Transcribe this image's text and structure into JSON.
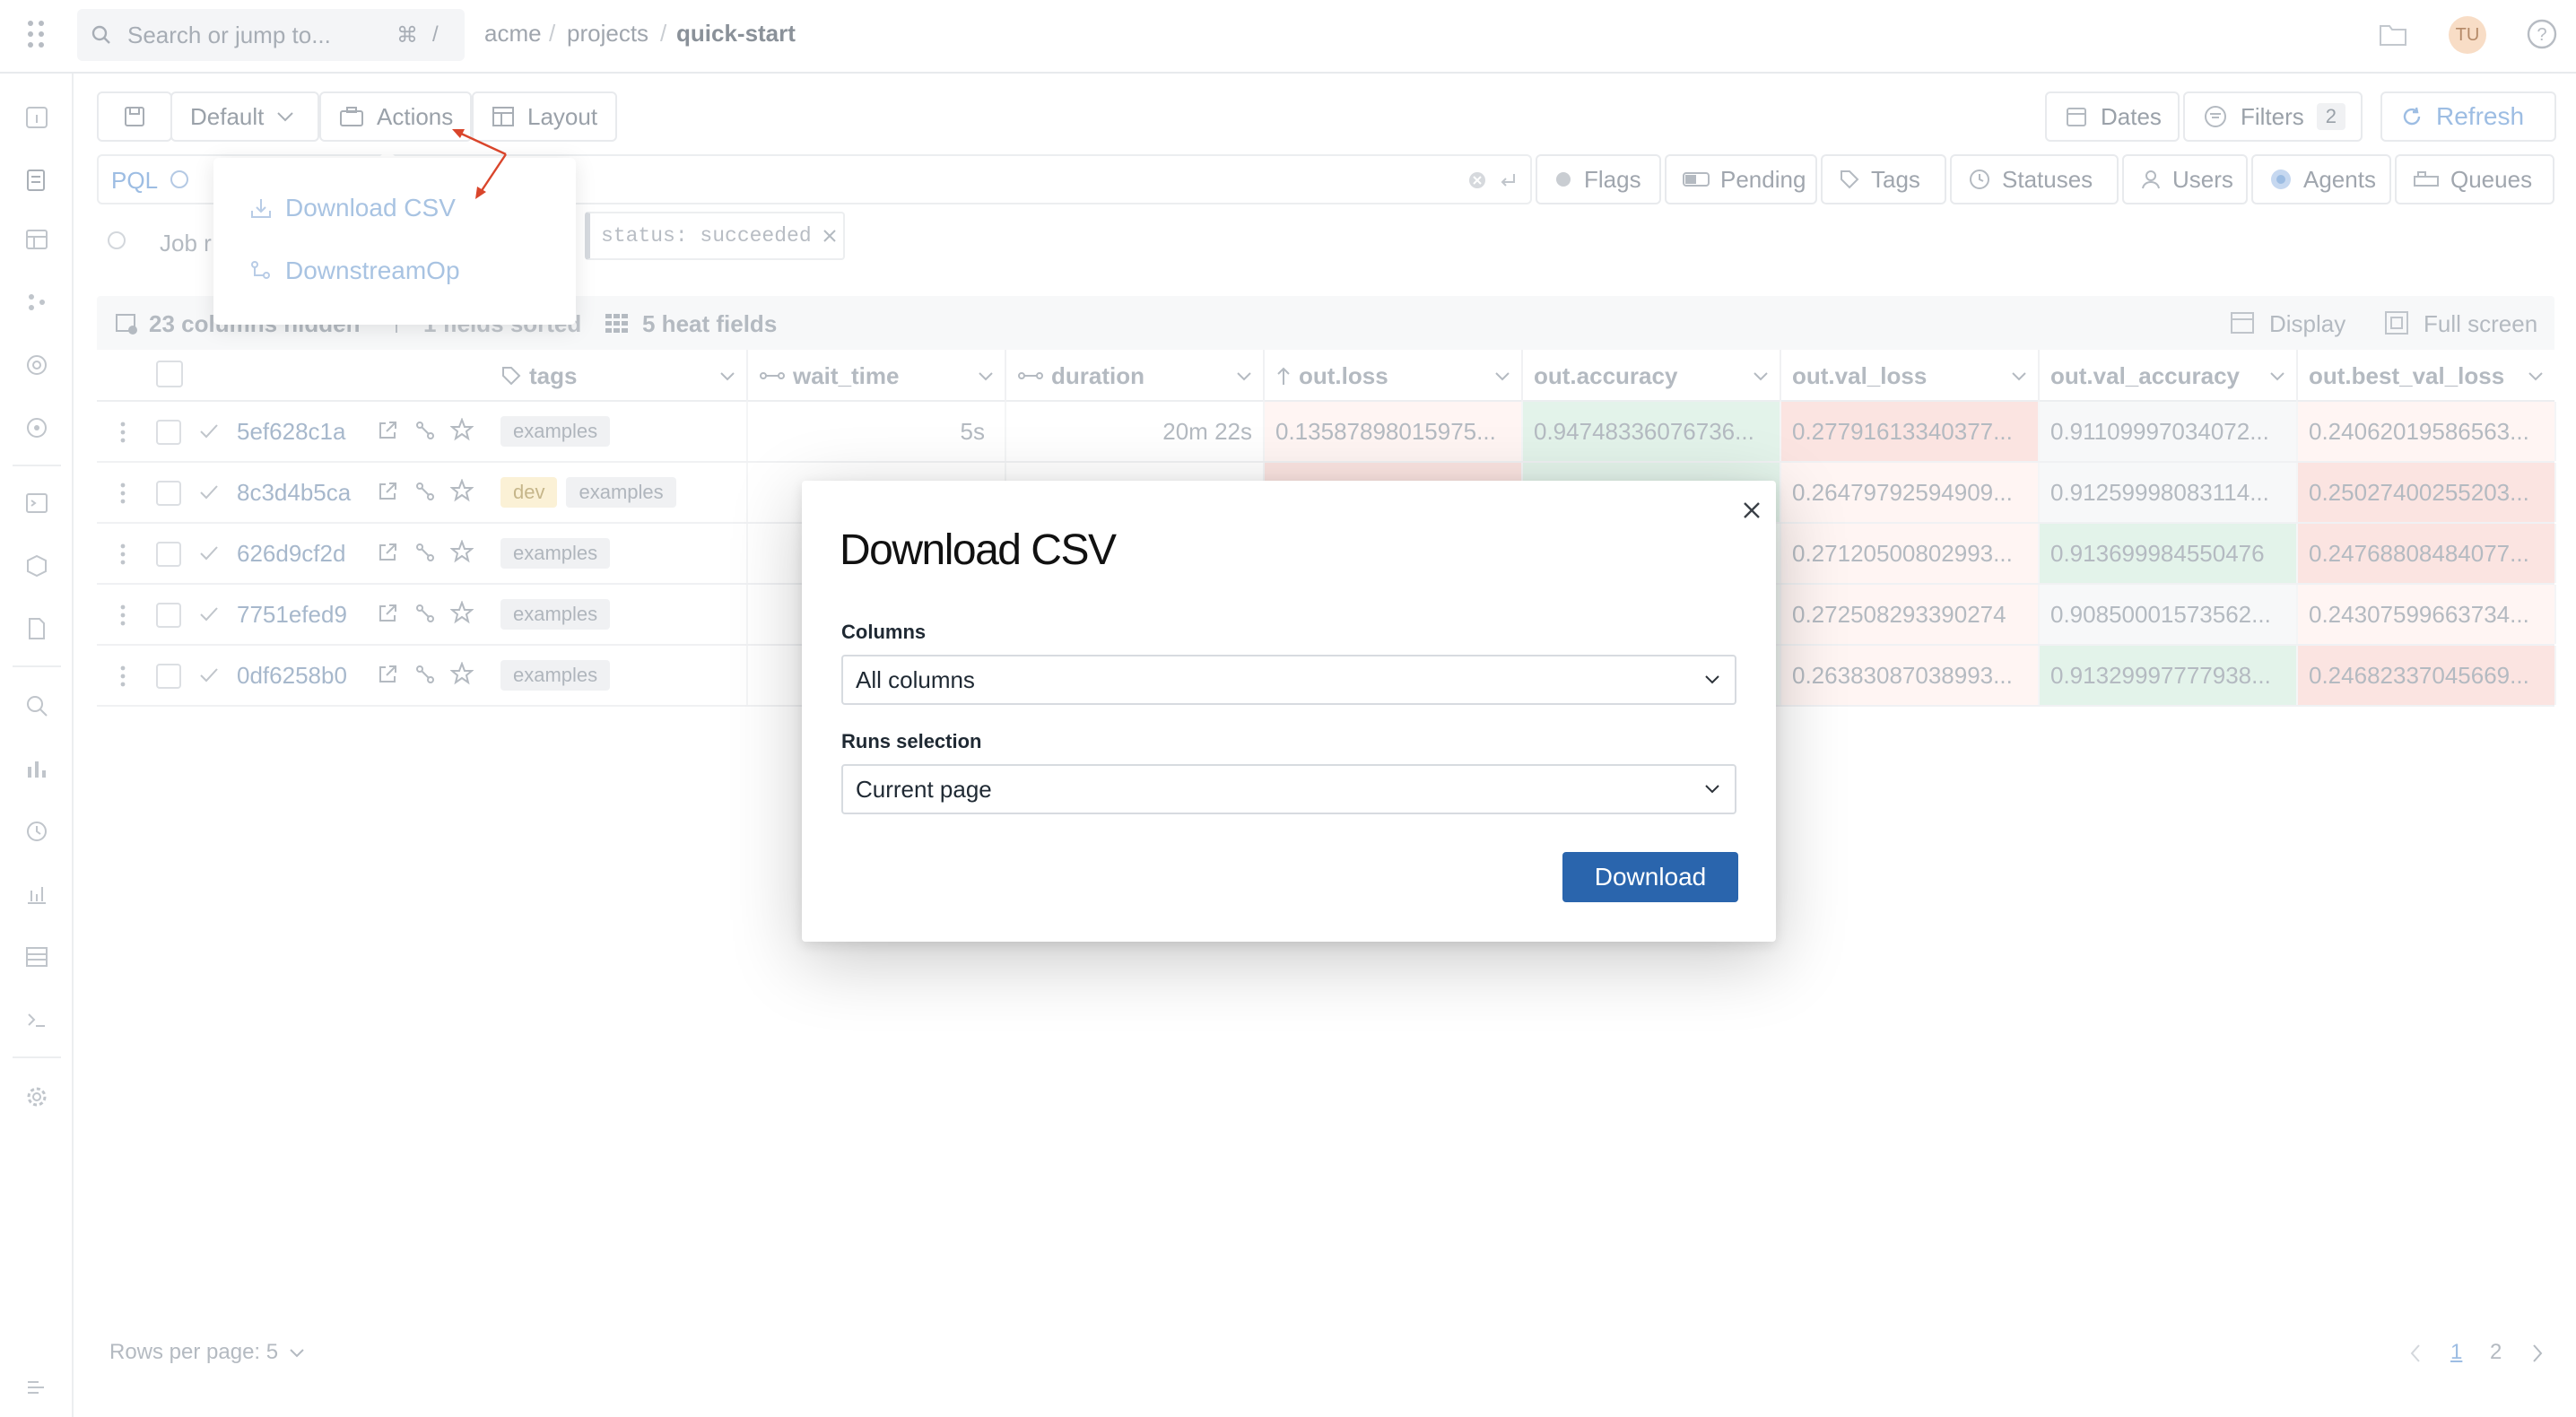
{
  "topbar": {
    "search_placeholder": "Search or jump to...",
    "shortcut_cmd": "⌘",
    "shortcut_slash": "/",
    "breadcrumb": [
      "acme",
      "projects",
      "quick-start"
    ],
    "breadcrumb_sep": "/",
    "avatar_initials": "TU"
  },
  "toolbar": {
    "default_label": "Default",
    "actions_label": "Actions",
    "layout_label": "Layout",
    "dates_label": "Dates",
    "filters_label": "Filters",
    "filters_count": "2",
    "refresh_label": "Refresh"
  },
  "actions_menu": {
    "items": [
      {
        "label": "Download CSV"
      },
      {
        "label": "DownstreamOp"
      }
    ]
  },
  "filterbar": {
    "pql_label": "PQL",
    "flags": "Flags",
    "pending": "Pending",
    "tags": "Tags",
    "statuses": "Statuses",
    "users": "Users",
    "agents": "Agents",
    "queues": "Queues",
    "job_label": "Job r",
    "status_chip": "status: succeeded"
  },
  "table_toolbar": {
    "columns_hidden": "23 columns hidden",
    "fields_sorted": "1 fields sorted",
    "heat_fields": "5 heat fields",
    "display": "Display",
    "full_screen": "Full screen"
  },
  "table": {
    "headers": [
      "tags",
      "wait_time",
      "duration",
      "out.loss",
      "out.accuracy",
      "out.val_loss",
      "out.val_accuracy",
      "out.best_val_loss"
    ],
    "rows": [
      {
        "uuid": "5ef628c1a",
        "tags": [
          "examples"
        ],
        "wait_time": "5s",
        "duration": "20m 22s",
        "loss": "0.13587898015975...",
        "accuracy": "0.94748336076736...",
        "val_loss": "0.27791613340377...",
        "val_accuracy": "0.91109997034072...",
        "best_val_loss": "0.24062019586563..."
      },
      {
        "uuid": "8c3d4b5ca",
        "tags": [
          "dev",
          "examples"
        ],
        "wait_time": "",
        "duration": "",
        "loss": "",
        "accuracy": "",
        "val_loss": "0.26479792594909...",
        "val_accuracy": "0.91259998083114...",
        "best_val_loss": "0.25027400255203..."
      },
      {
        "uuid": "626d9cf2d",
        "tags": [
          "examples"
        ],
        "wait_time": "",
        "duration": "",
        "loss": "",
        "accuracy": "",
        "val_loss": "0.27120500802993...",
        "val_accuracy": "0.913699984550476",
        "best_val_loss": "0.24768808484077..."
      },
      {
        "uuid": "7751efed9",
        "tags": [
          "examples"
        ],
        "wait_time": "",
        "duration": "",
        "loss": "",
        "accuracy": "",
        "val_loss": "0.272508293390274",
        "val_accuracy": "0.90850001573562...",
        "best_val_loss": "0.24307599663734..."
      },
      {
        "uuid": "0df6258b0",
        "tags": [
          "examples"
        ],
        "wait_time": "",
        "duration": "",
        "loss": "",
        "accuracy": "",
        "val_loss": "0.26383087038993...",
        "val_accuracy": "0.91329997777938...",
        "best_val_loss": "0.24682337045669..."
      }
    ]
  },
  "pagination": {
    "rows_per_page": "Rows per page: 5",
    "pages": [
      "1",
      "2"
    ]
  },
  "modal": {
    "title": "Download CSV",
    "columns_label": "Columns",
    "columns_value": "All columns",
    "runs_label": "Runs selection",
    "runs_value": "Current page",
    "download_button": "Download"
  },
  "colors": {
    "primary": "#2a65ad",
    "heat_red": "#fbe4e1",
    "heat_green": "#e3f3ea",
    "annotation_arrow": "#d9452b"
  }
}
